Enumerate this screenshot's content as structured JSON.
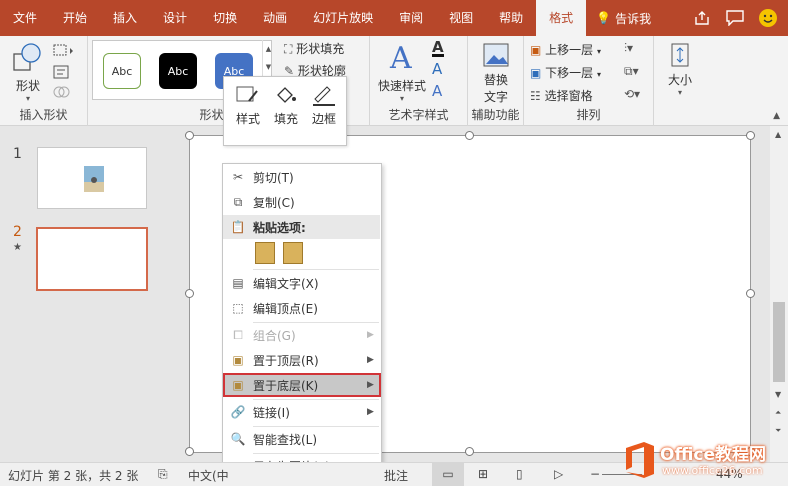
{
  "tabs": [
    "文件",
    "开始",
    "插入",
    "设计",
    "切换",
    "动画",
    "幻灯片放映",
    "审阅",
    "视图",
    "帮助",
    "格式"
  ],
  "active_tab": "格式",
  "tell_me": "告诉我",
  "ribbon": {
    "insert_shapes": {
      "label": "插入形状",
      "shapes_btn": "形状"
    },
    "shape_styles": {
      "label": "形状样式",
      "style_sample": "Abc",
      "fill": "形状填充",
      "outline": "形状轮廓"
    },
    "art_text": {
      "label": "艺术字样式",
      "quick_styles": "快速样式"
    },
    "accessibility": {
      "label": "辅助功能",
      "alt_text_1": "替换",
      "alt_text_2": "文字"
    },
    "arrange": {
      "label": "排列",
      "bring_forward": "上移一层",
      "send_backward": "下移一层",
      "selection_pane": "选择窗格"
    },
    "size": {
      "label": "大小"
    }
  },
  "mini_toolbar": {
    "style": "样式",
    "fill": "填充",
    "border": "边框"
  },
  "slides": [
    {
      "number": "1"
    },
    {
      "number": "2",
      "marker": "★"
    }
  ],
  "context_menu": {
    "cut": "剪切(T)",
    "copy": "复制(C)",
    "paste_options": "粘贴选项:",
    "edit_text": "编辑文字(X)",
    "edit_points": "编辑顶点(E)",
    "group": "组合(G)",
    "bring_to_front": "置于顶层(R)",
    "send_to_back": "置于底层(K)",
    "link": "链接(I)",
    "smart_lookup": "智能查找(L)",
    "save_as_picture": "另存为图片(S)..."
  },
  "status": {
    "slide_info": "幻灯片 第 2 张，共 2 张",
    "language": "中文(中",
    "comments": "批注",
    "zoom": "44%"
  },
  "watermark": {
    "brand": "Office教程网",
    "url": "www.office26.com"
  },
  "colors": {
    "accent": "#b7472a",
    "highlight_border": "#d13438"
  }
}
